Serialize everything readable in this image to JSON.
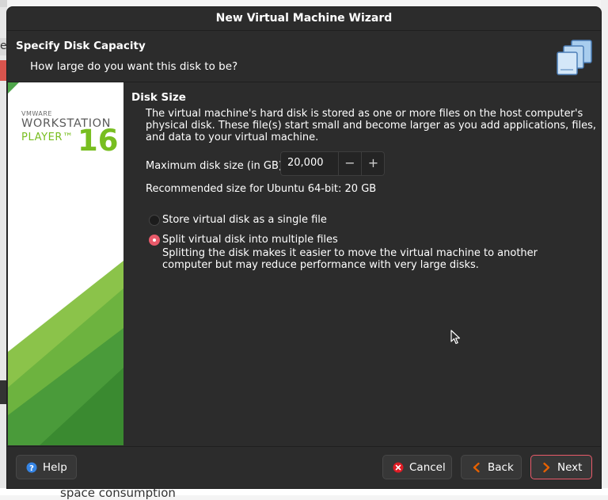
{
  "window": {
    "title": "New Virtual Machine Wizard"
  },
  "header": {
    "title": "Specify Disk Capacity",
    "subtitle": "How large do you want this disk to be?",
    "icon": "stacked-disks-icon"
  },
  "banner": {
    "brand": "VMWARE",
    "product": "WORKSTATION",
    "edition": "PLAYER™",
    "version": "16",
    "accent_color": "#78be20"
  },
  "disk_size": {
    "section_title": "Disk Size",
    "description": "The virtual machine's hard disk is stored as one or more files on the host computer's physical disk. These file(s) start small and become larger as you add applications, files, and data to your virtual machine.",
    "max_size_label": "Maximum disk size (in GB):",
    "max_size_value": "20,000",
    "minus_symbol": "−",
    "plus_symbol": "+",
    "recommendation": "Recommended size for Ubuntu 64-bit: 20 GB"
  },
  "storage_options": {
    "single_file_label": "Store virtual disk as a single file",
    "single_file_selected": false,
    "split_label": "Split virtual disk into multiple files",
    "split_selected": true,
    "split_note": "Splitting the disk makes it easier to move the virtual machine to another computer but may reduce performance with very large disks."
  },
  "footer": {
    "help_label": "Help",
    "cancel_label": "Cancel",
    "back_label": "Back",
    "next_label": "Next"
  },
  "background": {
    "left_tab_char": "e",
    "bottom_text": "space consumption"
  },
  "colors": {
    "accent_red": "#e95a6a",
    "help_blue": "#3584e4",
    "cancel_red": "#e01b24",
    "back_orange": "#e66100"
  }
}
